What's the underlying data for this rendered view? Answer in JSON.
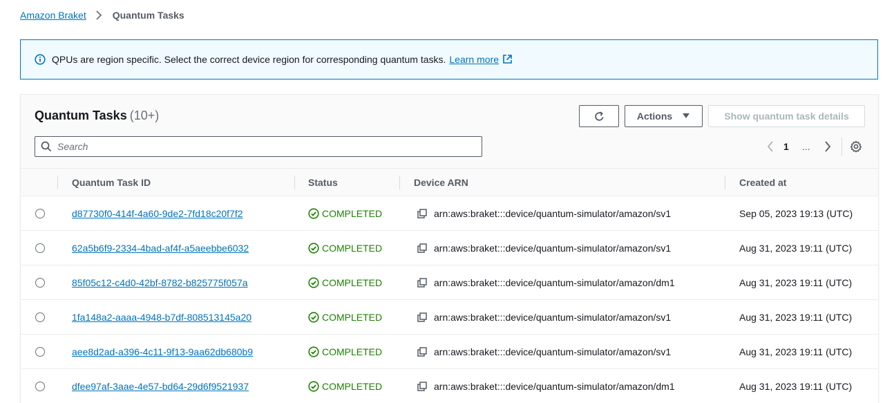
{
  "breadcrumb": {
    "parent": "Amazon Braket",
    "current": "Quantum Tasks"
  },
  "banner": {
    "text": "QPUs are region specific. Select the correct device region for corresponding quantum tasks.",
    "link": "Learn more"
  },
  "panel": {
    "title": "Quantum Tasks",
    "count": "(10+)",
    "actions_label": "Actions",
    "details_label": "Show quantum task details",
    "search_placeholder": "Search"
  },
  "pagination": {
    "current_page": "1",
    "ellipsis": "..."
  },
  "table": {
    "columns": {
      "id": "Quantum Task ID",
      "status": "Status",
      "arn": "Device ARN",
      "created": "Created at"
    },
    "rows": [
      {
        "id": "d87730f0-414f-4a60-9de2-7fd18c20f7f2",
        "status": "COMPLETED",
        "arn": "arn:aws:braket:::device/quantum-simulator/amazon/sv1",
        "created": "Sep 05, 2023 19:13 (UTC)"
      },
      {
        "id": "62a5b6f9-2334-4bad-af4f-a5aeebbe6032",
        "status": "COMPLETED",
        "arn": "arn:aws:braket:::device/quantum-simulator/amazon/sv1",
        "created": "Aug 31, 2023 19:11 (UTC)"
      },
      {
        "id": "85f05c12-c4d0-42bf-8782-b825775f057a",
        "status": "COMPLETED",
        "arn": "arn:aws:braket:::device/quantum-simulator/amazon/dm1",
        "created": "Aug 31, 2023 19:11 (UTC)"
      },
      {
        "id": "1fa148a2-aaaa-4948-b7df-808513145a20",
        "status": "COMPLETED",
        "arn": "arn:aws:braket:::device/quantum-simulator/amazon/sv1",
        "created": "Aug 31, 2023 19:11 (UTC)"
      },
      {
        "id": "aee8d2ad-a396-4c11-9f13-9aa62db680b9",
        "status": "COMPLETED",
        "arn": "arn:aws:braket:::device/quantum-simulator/amazon/sv1",
        "created": "Aug 31, 2023 19:11 (UTC)"
      },
      {
        "id": "dfee97af-3aae-4e57-bd64-29d6f9521937",
        "status": "COMPLETED",
        "arn": "arn:aws:braket:::device/quantum-simulator/amazon/dm1",
        "created": "Aug 31, 2023 19:11 (UTC)"
      }
    ]
  },
  "colors": {
    "link": "#0073bb",
    "success": "#1d8102",
    "banner_bg": "#f1faff",
    "banner_border": "#0073bb"
  },
  "icons": [
    "chevron-right-icon",
    "info-icon",
    "external-link-icon",
    "refresh-icon",
    "caret-down-icon",
    "search-icon",
    "chevron-left-icon",
    "settings-icon",
    "check-circle-icon",
    "copy-icon"
  ]
}
